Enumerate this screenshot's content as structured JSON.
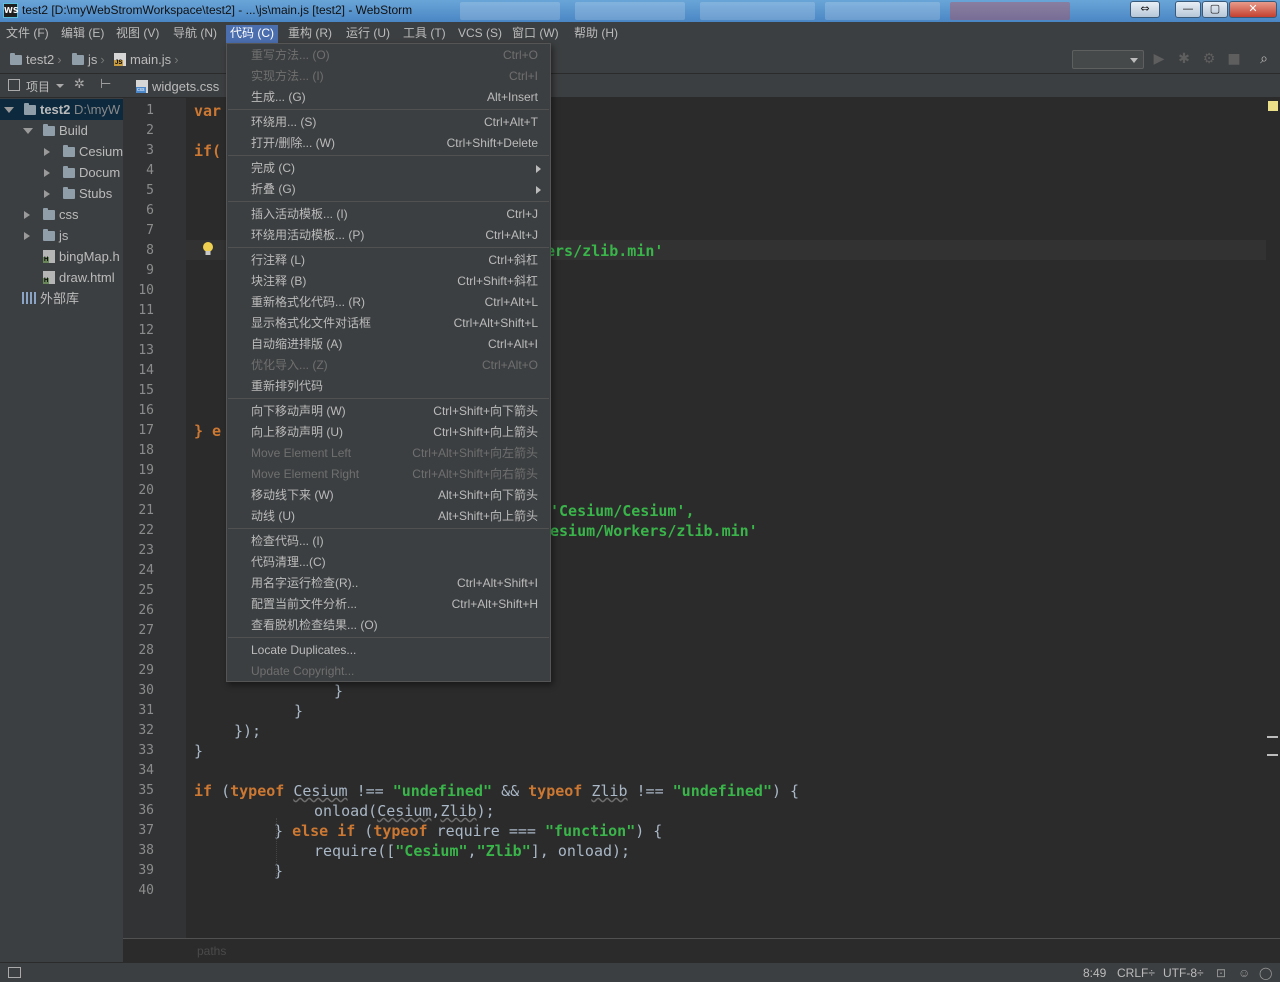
{
  "window": {
    "title": "test2 [D:\\myWebStromWorkspace\\test2] - ...\\js\\main.js [test2] - WebStorm",
    "app_icon_text": "WS",
    "controls": [
      "⇔",
      "—",
      "▢",
      "✕"
    ]
  },
  "menubar": [
    "文件 (F)",
    "编辑 (E)",
    "视图 (V)",
    "导航 (N)",
    "代码 (C)",
    "重构 (R)",
    "运行 (U)",
    "工具 (T)",
    "VCS (S)",
    "窗口 (W)",
    "帮助 (H)"
  ],
  "navbar": {
    "crumbs": [
      "test2",
      "js",
      "main.js"
    ]
  },
  "project": {
    "header_label": "项目",
    "tree": [
      {
        "label": "test2",
        "suffix": "D:\\myW",
        "level": 0,
        "state": "expanded",
        "kind": "folder"
      },
      {
        "label": "Build",
        "level": 1,
        "state": "expanded",
        "kind": "folder"
      },
      {
        "label": "Cesium",
        "level": 2,
        "state": "collapsed",
        "kind": "folder"
      },
      {
        "label": "Docum",
        "level": 2,
        "state": "collapsed",
        "kind": "folder"
      },
      {
        "label": "Stubs",
        "level": 2,
        "state": "collapsed",
        "kind": "folder"
      },
      {
        "label": "css",
        "level": 1,
        "state": "collapsed",
        "kind": "folder"
      },
      {
        "label": "js",
        "level": 1,
        "state": "collapsed",
        "kind": "folder"
      },
      {
        "label": "bingMap.h",
        "level": 1,
        "kind": "html"
      },
      {
        "label": "draw.html",
        "level": 1,
        "kind": "html"
      },
      {
        "label": "外部库",
        "level": 0,
        "kind": "library"
      }
    ]
  },
  "editor": {
    "tab": "widgets.css",
    "line_numbers": [
      "1",
      "2",
      "3",
      "4",
      "5",
      "6",
      "7",
      "8",
      "9",
      "10",
      "11",
      "12",
      "13",
      "14",
      "15",
      "16",
      "17",
      "18",
      "19",
      "20",
      "21",
      "22",
      "23",
      "24",
      "25",
      "26",
      "27",
      "28",
      "29",
      "30",
      "31",
      "32",
      "33",
      "34",
      "35",
      "36",
      "37",
      "38",
      "39",
      "40"
    ],
    "visible_code": {
      "l1": "var",
      "l3": "if(",
      "l8": "ers/zlib.min'",
      "l17": "} e",
      "l21": "'Cesium/Cesium',",
      "l22": "esium/Workers/zlib.min'",
      "l30": "}",
      "l31": "}",
      "l32": "});",
      "l33": "}",
      "l35a": "if",
      "l35b": "typeof",
      "l35c": "Cesium",
      "l35d": "!==",
      "l35e": "\"undefined\"",
      "l35f": "&&",
      "l35g": "typeof",
      "l35h": "Zlib",
      "l35i": "!==",
      "l35j": "\"undefined\"",
      "l36a": "onload(",
      "l36b": "Cesium",
      "l36c": "Zlib",
      "l36d": ");",
      "l37a": "} ",
      "l37b": "else if",
      "l37c": "typeof",
      "l37d": "require",
      "l37e": "===",
      "l37f": "\"function\"",
      "l37g": ") {",
      "l38a": "require([",
      "l38b": "\"Cesium\"",
      "l38c": "\"Zlib\"",
      "l38d": "], onload);",
      "l39": "}"
    },
    "breadcrumb_placeholder": "paths"
  },
  "code_menu": {
    "items": [
      {
        "label": "重写方法... (O)",
        "shortcut": "Ctrl+O",
        "disabled": true
      },
      {
        "label": "实现方法... (I)",
        "shortcut": "Ctrl+I",
        "disabled": true
      },
      {
        "label": "生成... (G)",
        "shortcut": "Alt+Insert"
      },
      {
        "sep": true
      },
      {
        "label": "环绕用... (S)",
        "shortcut": "Ctrl+Alt+T"
      },
      {
        "label": "打开/删除... (W)",
        "shortcut": "Ctrl+Shift+Delete"
      },
      {
        "sep": true
      },
      {
        "label": "完成 (C)",
        "submenu": true
      },
      {
        "label": "折叠 (G)",
        "submenu": true
      },
      {
        "sep": true
      },
      {
        "label": "插入活动模板... (I)",
        "shortcut": "Ctrl+J"
      },
      {
        "label": "环绕用活动模板... (P)",
        "shortcut": "Ctrl+Alt+J"
      },
      {
        "sep": true
      },
      {
        "label": "行注释 (L)",
        "shortcut": "Ctrl+斜杠"
      },
      {
        "label": "块注释 (B)",
        "shortcut": "Ctrl+Shift+斜杠"
      },
      {
        "label": "重新格式化代码... (R)",
        "shortcut": "Ctrl+Alt+L"
      },
      {
        "label": "显示格式化文件对话框",
        "shortcut": "Ctrl+Alt+Shift+L"
      },
      {
        "label": "自动缩进排版 (A)",
        "shortcut": "Ctrl+Alt+I"
      },
      {
        "label": "优化导入... (Z)",
        "shortcut": "Ctrl+Alt+O",
        "disabled": true
      },
      {
        "label": "重新排列代码",
        "shortcut": ""
      },
      {
        "sep": true
      },
      {
        "label": "向下移动声明 (W)",
        "shortcut": "Ctrl+Shift+向下箭头"
      },
      {
        "label": "向上移动声明 (U)",
        "shortcut": "Ctrl+Shift+向上箭头"
      },
      {
        "label": "Move Element Left",
        "shortcut": "Ctrl+Alt+Shift+向左箭头",
        "disabled": true
      },
      {
        "label": "Move Element Right",
        "shortcut": "Ctrl+Alt+Shift+向右箭头",
        "disabled": true
      },
      {
        "label": "移动线下来 (W)",
        "shortcut": "Alt+Shift+向下箭头"
      },
      {
        "label": "动线 (U)",
        "shortcut": "Alt+Shift+向上箭头"
      },
      {
        "sep": true
      },
      {
        "label": "检查代码... (I)",
        "shortcut": ""
      },
      {
        "label": "代码清理...(C)",
        "shortcut": ""
      },
      {
        "label": "用名字运行检查(R)..",
        "shortcut": "Ctrl+Alt+Shift+I"
      },
      {
        "label": "配置当前文件分析...",
        "shortcut": "Ctrl+Alt+Shift+H"
      },
      {
        "label": "查看脱机检查结果... (O)",
        "shortcut": ""
      },
      {
        "sep": true
      },
      {
        "label": "Locate Duplicates...",
        "shortcut": ""
      },
      {
        "label": "Update Copyright...",
        "shortcut": "",
        "disabled": true
      }
    ]
  },
  "status": {
    "position": "8:49",
    "line_sep": "CRLF÷",
    "encoding": "UTF-8÷"
  },
  "colors": {
    "menu_active": "#4b6eaf",
    "keyword": "#cc7832",
    "string": "#39b54a"
  }
}
